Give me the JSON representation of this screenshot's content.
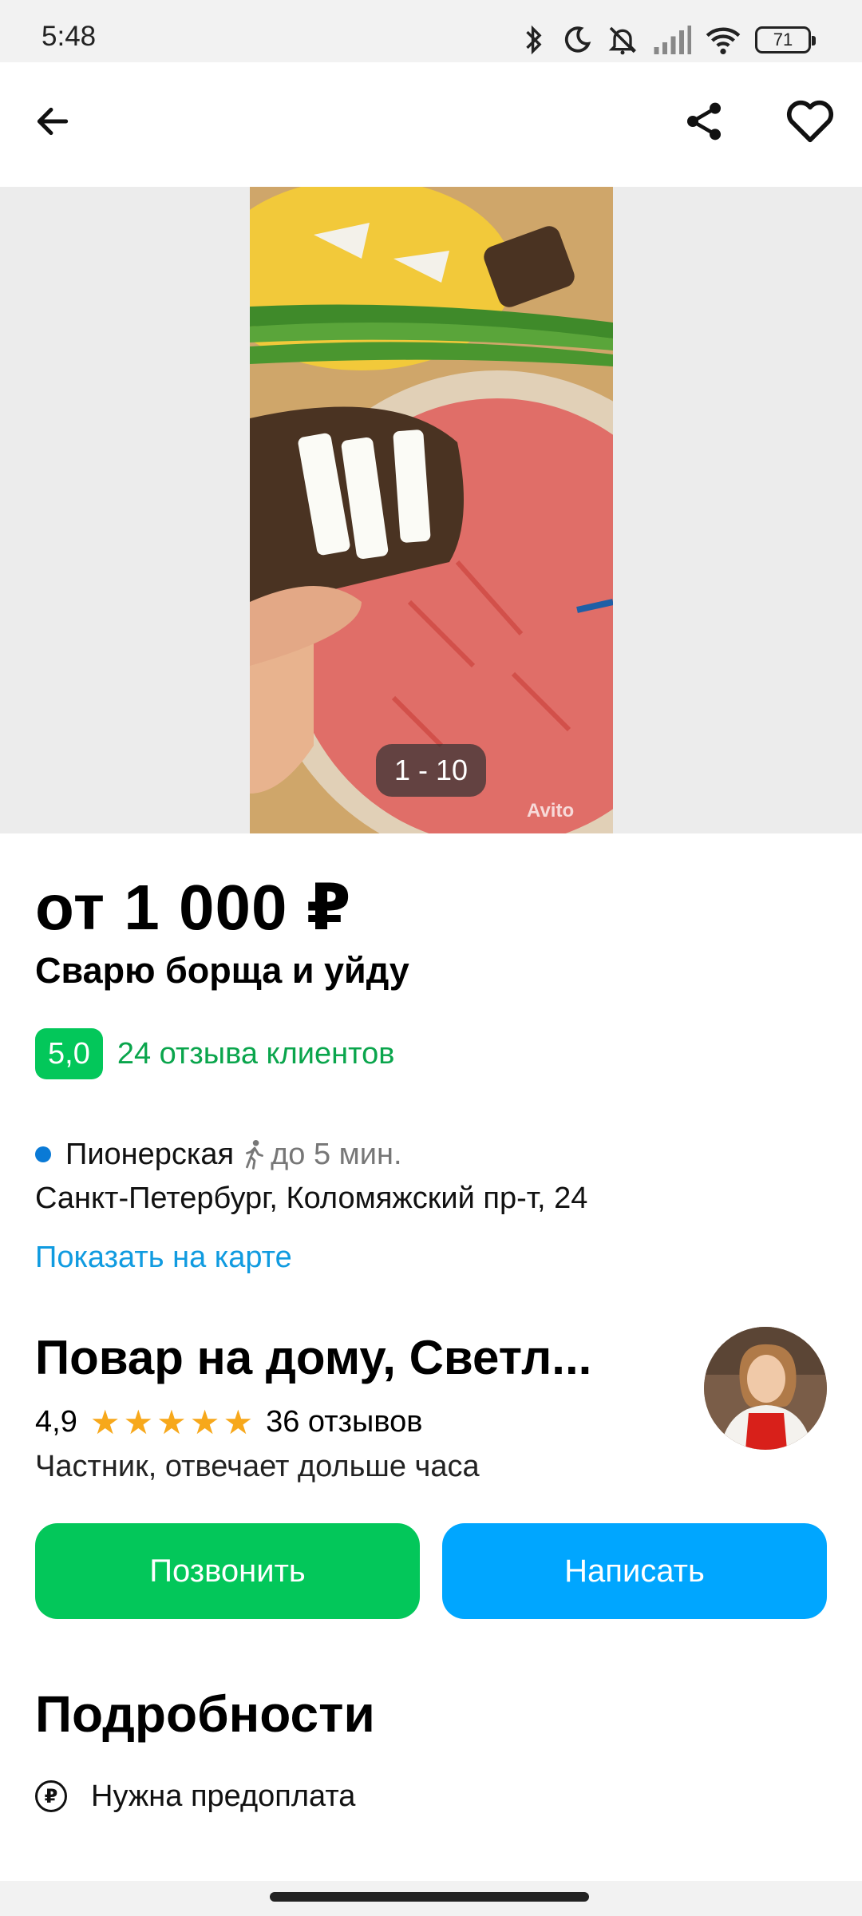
{
  "status_bar": {
    "time": "5:48",
    "battery": "71",
    "icons": [
      "bluetooth-icon",
      "moon-icon",
      "mute-icon",
      "signal-icon",
      "wifi-icon",
      "battery-icon"
    ]
  },
  "toolbar": {
    "icons": [
      "back-arrow-icon",
      "share-icon",
      "heart-icon"
    ]
  },
  "gallery": {
    "counter": "1 - 10",
    "watermark": "Avito"
  },
  "listing": {
    "price": "от 1 000 ₽",
    "title": "Сварю борща и уйду",
    "rating": "5,0",
    "reviews_link": "24 отзыва клиентов"
  },
  "location": {
    "metro": "Пионерская",
    "walk_time": "до 5 мин.",
    "address": "Санкт-Петербург, Коломяжский пр-т, 24",
    "map_link": "Показать на карте"
  },
  "seller": {
    "name": "Повар на дому, Светл...",
    "rating": "4,9",
    "stars": 5,
    "reviews": "36 отзывов",
    "info": "Частник, отвечает дольше часа"
  },
  "actions": {
    "call_label": "Позвонить",
    "write_label": "Написать"
  },
  "details": {
    "title": "Подробности",
    "items": [
      {
        "icon": "ruble-icon",
        "label": "Нужна предоплата"
      }
    ]
  },
  "colors": {
    "accent_green": "#03c75a",
    "accent_blue": "#00a6ff",
    "link_blue": "#109be0",
    "star": "#f7a81b",
    "metro_dot": "#0a7ad6"
  }
}
